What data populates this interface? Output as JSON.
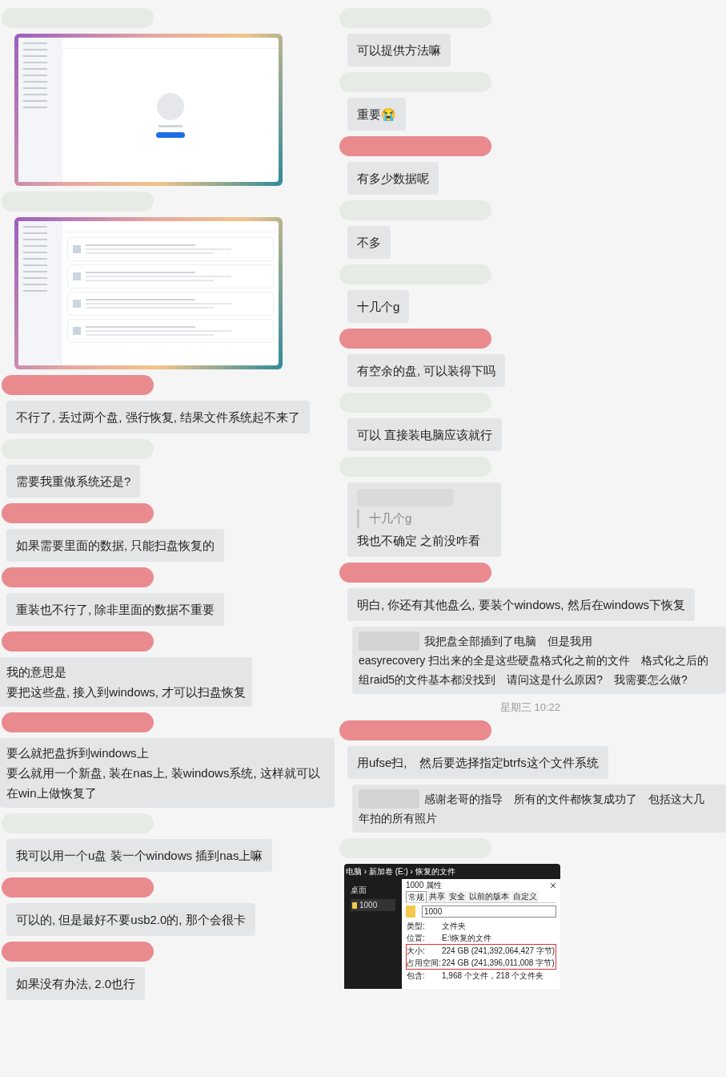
{
  "left_column": [
    {
      "kind": "blur",
      "color": "#e6ebe6"
    },
    {
      "kind": "emptyscreenshot"
    },
    {
      "kind": "blur",
      "color": "#e6ebe6"
    },
    {
      "kind": "diskscreenshot"
    },
    {
      "kind": "blur",
      "color": "#e98a8f"
    },
    {
      "kind": "message",
      "text": "不行了, 丢过两个盘, 强行恢复, 结果文件系统起不来了"
    },
    {
      "kind": "blur",
      "color": "#e6ebe6"
    },
    {
      "kind": "message",
      "text": "需要我重做系统还是?"
    },
    {
      "kind": "blur",
      "color": "#e98a8f"
    },
    {
      "kind": "message",
      "text": "如果需要里面的数据, 只能扫盘恢复的"
    },
    {
      "kind": "blur",
      "color": "#e98a8f"
    },
    {
      "kind": "message",
      "text": "重装也不行了, 除非里面的数据不重要"
    },
    {
      "kind": "blur",
      "color": "#e98a8f"
    },
    {
      "kind": "multiline",
      "lines": [
        "我的意思是",
        "要把这些盘, 接入到windows, 才可以扫盘恢复"
      ]
    },
    {
      "kind": "blur",
      "color": "#e98a8f"
    },
    {
      "kind": "multiline",
      "lines": [
        "要么就把盘拆到windows上",
        "要么就用一个新盘, 装在nas上, 装windows系统, 这样就可以在win上做恢复了"
      ]
    },
    {
      "kind": "blur",
      "color": "#e6ebe6"
    },
    {
      "kind": "message",
      "text": "我可以用一个u盘 装一个windows 插到nas上嘛"
    },
    {
      "kind": "blur",
      "color": "#e98a8f"
    },
    {
      "kind": "message",
      "text": "可以的, 但是最好不要usb2.0的, 那个会很卡"
    },
    {
      "kind": "blur",
      "color": "#e98a8f"
    },
    {
      "kind": "message",
      "text": "如果没有办法, 2.0也行"
    }
  ],
  "right_column": [
    {
      "kind": "blur",
      "color": "#e6ebe6"
    },
    {
      "kind": "message",
      "text": "可以提供方法嘛"
    },
    {
      "kind": "blur",
      "color": "#e6ebe6"
    },
    {
      "kind": "message",
      "text": "重要😭"
    },
    {
      "kind": "blur",
      "color": "#e98a8f"
    },
    {
      "kind": "message",
      "text": "有多少数据呢"
    },
    {
      "kind": "blur",
      "color": "#e6ebe6"
    },
    {
      "kind": "message",
      "text": "不多"
    },
    {
      "kind": "blur",
      "color": "#e6ebe6"
    },
    {
      "kind": "message",
      "text": "十几个g"
    },
    {
      "kind": "blur",
      "color": "#e98a8f"
    },
    {
      "kind": "message",
      "text": "有空余的盘, 可以装得下吗"
    },
    {
      "kind": "blur",
      "color": "#e6ebe6"
    },
    {
      "kind": "message",
      "text": "可以 直接装电脑应该就行"
    },
    {
      "kind": "blur",
      "color": "#e6ebe6"
    },
    {
      "kind": "reply",
      "quote": "十几个g",
      "text": "我也不确定 之前没咋看"
    },
    {
      "kind": "blur",
      "color": "#e98a8f"
    },
    {
      "kind": "message",
      "text": "明白, 你还有其他盘么, 要装个windows, 然后在windows下恢复"
    },
    {
      "kind": "named_message",
      "head": "我把盘全部插到了电脑　但是我用",
      "text": "easyrecovery 扫出来的全是这些硬盘格式化之前的文件　格式化之后的组raid5的文件基本都没找到　请问这是什么原因?　我需要怎么做?"
    },
    {
      "kind": "time",
      "text": "星期三 10:22"
    },
    {
      "kind": "blur",
      "color": "#e98a8f"
    },
    {
      "kind": "message",
      "text": "用ufse扫,　然后要选择指定btrfs这个文件系统"
    },
    {
      "kind": "named_message",
      "head": "感谢老哥的指导　所有的文件都恢复成功了　包括这大几",
      "text": "年拍的所有照片"
    },
    {
      "kind": "blur",
      "color": "#e6ebe6"
    },
    {
      "kind": "properties_screenshot",
      "breadcrumb": "电脑 › 新加卷 (E:) › 恢复的文件",
      "nav_item": "桌面",
      "folder": "1000",
      "dialog_title": "1000 属性",
      "tabs": [
        {
          "label": "常规",
          "selected": true
        },
        {
          "label": "共享",
          "selected": false
        },
        {
          "label": "安全",
          "selected": false
        },
        {
          "label": "以前的版本",
          "selected": false
        },
        {
          "label": "自定义",
          "selected": false
        }
      ],
      "name_value": "1000",
      "rows": [
        {
          "label": "类型:",
          "value": "文件夹",
          "highlighted": false
        },
        {
          "label": "位置:",
          "value": "E:\\恢复的文件",
          "highlighted": false
        },
        {
          "label": "大小:",
          "value": "224 GB (241,392,064,427 字节)",
          "highlighted": true
        },
        {
          "label": "占用空间:",
          "value": "224 GB (241,396,011,008 字节)",
          "highlighted": true
        },
        {
          "label": "包含:",
          "value": "1,968 个文件，218 个文件夹",
          "highlighted": false
        }
      ]
    }
  ]
}
